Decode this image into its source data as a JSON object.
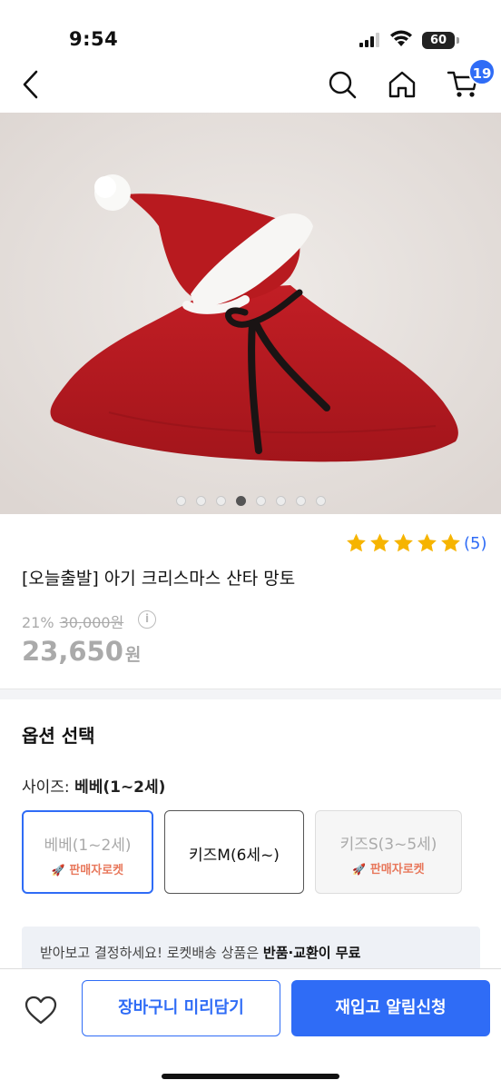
{
  "status_bar": {
    "time": "9:54",
    "battery": "60"
  },
  "nav": {
    "cart_count": "19"
  },
  "gallery": {
    "image_count": 8,
    "active_index": 3
  },
  "product": {
    "rating_stars": 5,
    "review_count": "(5)",
    "title": "[오늘출발] 아기 크리스마스 산타 망토",
    "discount_rate": "21%",
    "original_price": "30,000원",
    "price": "23,650",
    "price_unit": "원"
  },
  "options": {
    "heading": "옵션 선택",
    "size_label": "사이즈: ",
    "size_selected": "베베(1~2세)",
    "items": [
      {
        "name": "베베(1~2세)",
        "badge": "판매자로켓"
      },
      {
        "name": "키즈M(6세~)",
        "badge": ""
      },
      {
        "name": "키즈S(3~5세)",
        "badge": "판매자로켓"
      }
    ]
  },
  "notice": {
    "text": "받아보고 결정하세요! 로켓배송 상품은 ",
    "bold": "반품·교환이 무료"
  },
  "actions": {
    "cart_button": "장바구니 미리담기",
    "alert_button": "재입고 알림신청"
  },
  "colors": {
    "accent": "#2f6cf6",
    "star": "#f6b400",
    "rocket": "#e8785c",
    "cape": "#b81a1f"
  },
  "icons": [
    "back-arrow-icon",
    "search-icon",
    "home-icon",
    "cart-icon",
    "share-icon",
    "star-icon",
    "info-icon",
    "rocket-icon",
    "heart-icon"
  ]
}
